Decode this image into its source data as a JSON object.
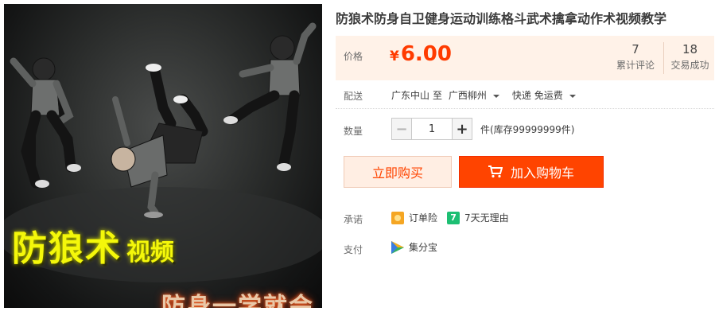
{
  "image": {
    "title_big": "防狼术",
    "title_small": "视频",
    "subtitle": "防身一学就会"
  },
  "product": {
    "title": "防狼术防身自卫健身运动训练格斗武术擒拿动作术视频教学"
  },
  "price": {
    "label": "价格",
    "currency": "¥",
    "value": "6.00",
    "color": "#ff3b00"
  },
  "stats": {
    "reviews_count": "7",
    "reviews_label": "累计评论",
    "sales_count": "18",
    "sales_label": "交易成功"
  },
  "shipping": {
    "label": "配送",
    "from": "广东中山",
    "to_word": "至",
    "destination": "广西柳州",
    "method": "快递 免运费"
  },
  "quantity": {
    "label": "数量",
    "minus": "−",
    "value": "1",
    "plus": "+",
    "stock": "件(库存99999999件)"
  },
  "actions": {
    "buy_now": "立即购买",
    "add_to_cart": "加入购物车",
    "accent": "#ff4400"
  },
  "promise": {
    "label": "承诺",
    "items": [
      {
        "icon": "order-insurance-icon",
        "text": "订单险"
      },
      {
        "icon": "seven-day-return-icon",
        "badge": "7",
        "text": "7天无理由"
      }
    ]
  },
  "payment": {
    "label": "支付",
    "items": [
      {
        "icon": "jifenbao-icon",
        "text": "集分宝"
      }
    ]
  }
}
